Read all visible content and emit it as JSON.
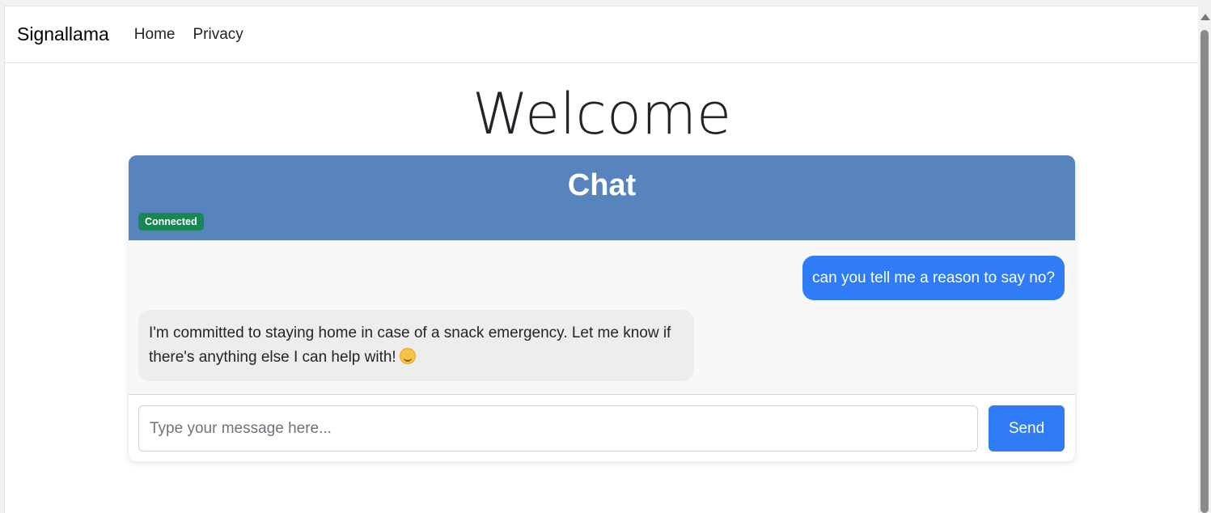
{
  "navbar": {
    "brand": "Signallama",
    "links": [
      "Home",
      "Privacy"
    ]
  },
  "page_heading": "Welcome",
  "chat": {
    "title": "Chat",
    "status": "Connected",
    "messages": [
      {
        "role": "user",
        "text": "can you tell me a reason to say no?"
      },
      {
        "role": "assistant",
        "text": "I'm committed to staying home in case of a snack emergency. Let me know if there's anything else I can help with!",
        "emoji": "smiling-face-icon"
      }
    ],
    "input_placeholder": "Type your message here...",
    "input_value": "",
    "send_label": "Send"
  },
  "colors": {
    "chat_header": "#5884be",
    "badge_connected": "#198754",
    "user_bubble": "#2f7cf6",
    "bot_bubble": "#ededed",
    "send_button": "#2f7cf6"
  }
}
